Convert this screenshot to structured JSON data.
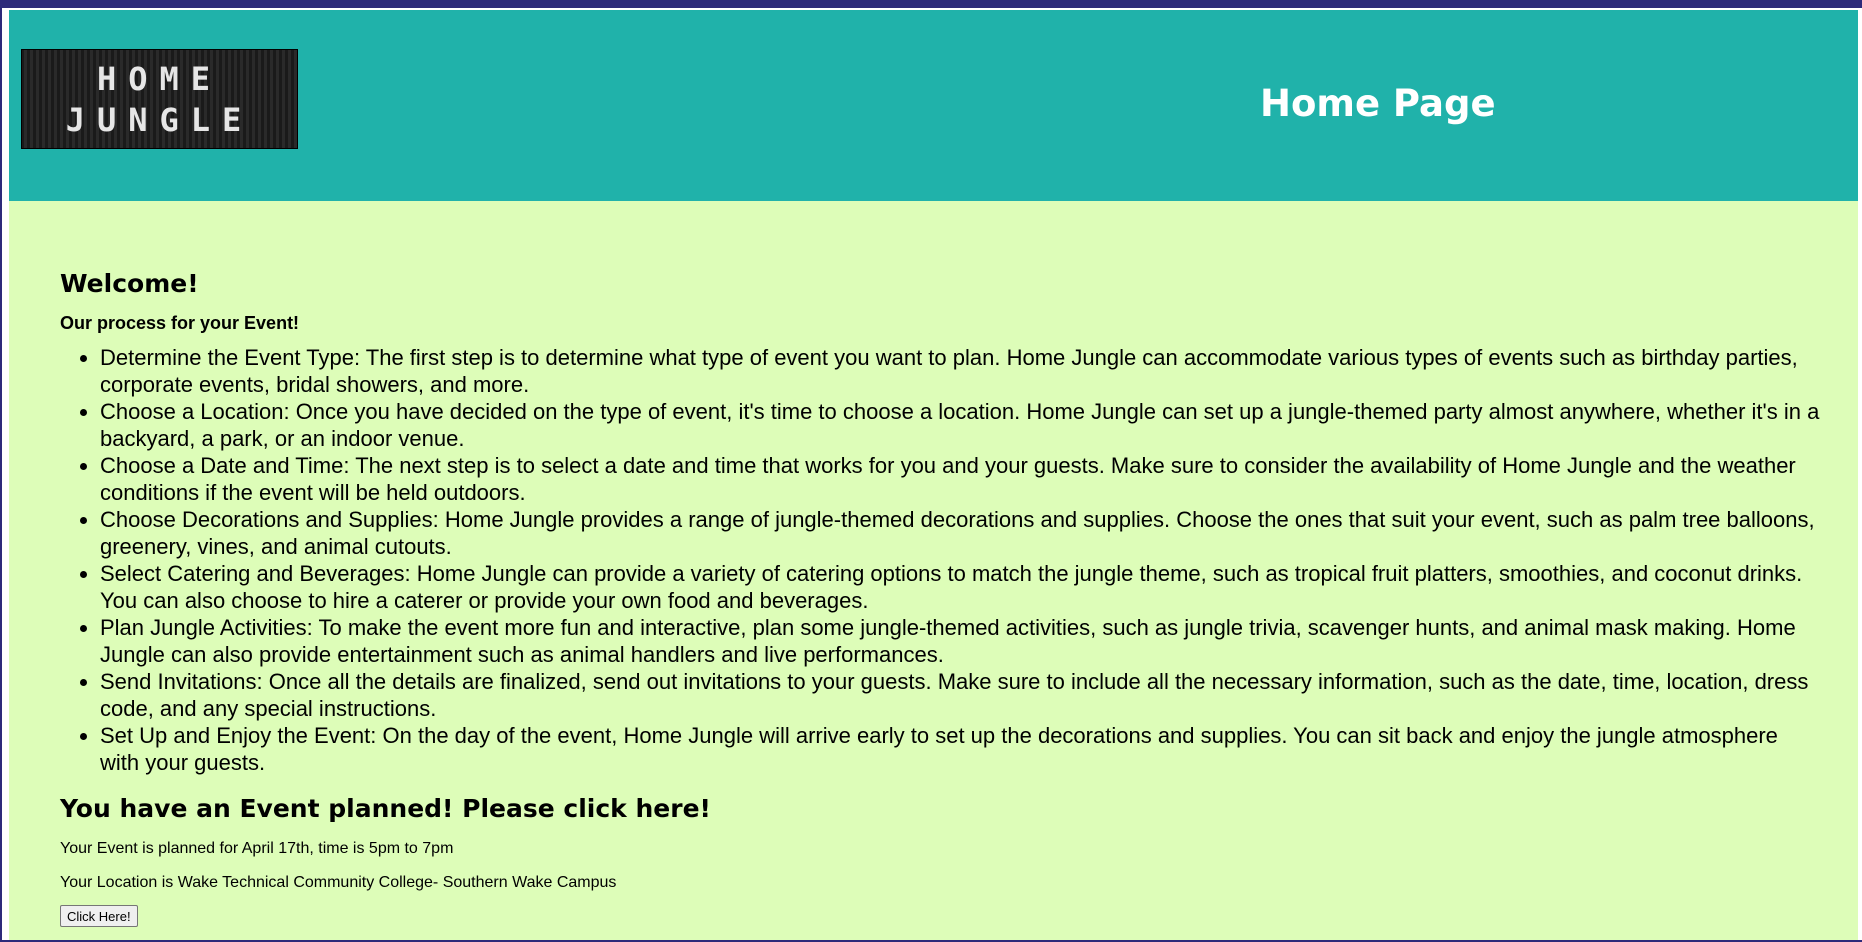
{
  "header": {
    "logo_line1": "HOME",
    "logo_line2": "JUNGLE",
    "title": "Home Page"
  },
  "main": {
    "welcome": "Welcome!",
    "process_title": "Our process for your Event!",
    "steps": [
      "Determine the Event Type: The first step is to determine what type of event you want to plan. Home Jungle can accommodate various types of events such as birthday parties, corporate events, bridal showers, and more.",
      "Choose a Location: Once you have decided on the type of event, it's time to choose a location. Home Jungle can set up a jungle-themed party almost anywhere, whether it's in a backyard, a park, or an indoor venue.",
      "Choose a Date and Time: The next step is to select a date and time that works for you and your guests. Make sure to consider the availability of Home Jungle and the weather conditions if the event will be held outdoors.",
      "Choose Decorations and Supplies: Home Jungle provides a range of jungle-themed decorations and supplies. Choose the ones that suit your event, such as palm tree balloons, greenery, vines, and animal cutouts.",
      "Select Catering and Beverages: Home Jungle can provide a variety of catering options to match the jungle theme, such as tropical fruit platters, smoothies, and coconut drinks. You can also choose to hire a caterer or provide your own food and beverages.",
      "Plan Jungle Activities: To make the event more fun and interactive, plan some jungle-themed activities, such as jungle trivia, scavenger hunts, and animal mask making. Home Jungle can also provide entertainment such as animal handlers and live performances.",
      "Send Invitations: Once all the details are finalized, send out invitations to your guests. Make sure to include all the necessary information, such as the date, time, location, dress code, and any special instructions.",
      "Set Up and Enjoy the Event: On the day of the event, Home Jungle will arrive early to set up the decorations and supplies. You can sit back and enjoy the jungle atmosphere with your guests."
    ],
    "event_heading": "You have an Event planned! Please click here!",
    "event_info": "Your Event is planned for April 17th, time is 5pm to 7pm",
    "event_location": "Your Location is Wake Technical Community College- Southern Wake Campus",
    "button_label": "Click Here!"
  },
  "colors": {
    "header_bg": "#20b2aa",
    "page_bg": "#ddfdb8",
    "frame": "#2d2a7a"
  }
}
